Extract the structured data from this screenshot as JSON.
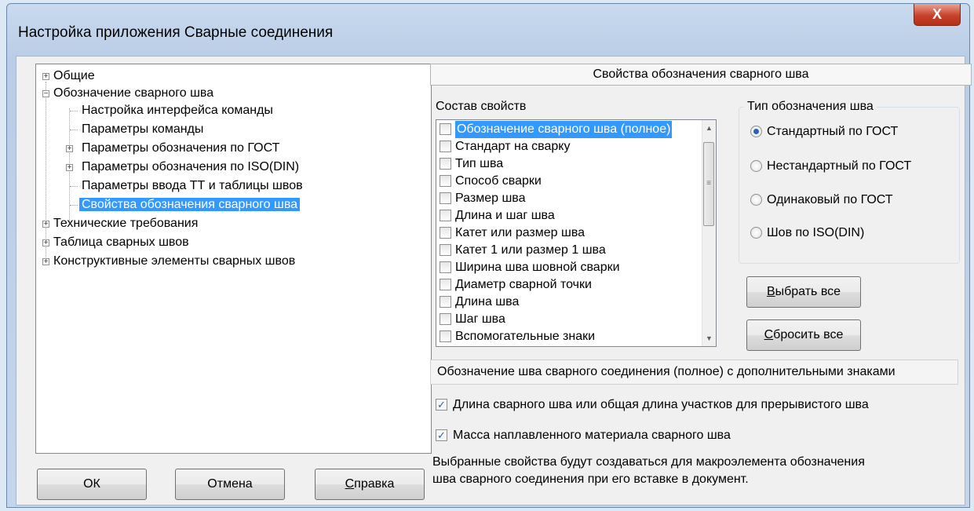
{
  "window": {
    "title": "Настройка приложения Сварные соединения",
    "close_label": "X"
  },
  "tree": {
    "items": [
      {
        "label": "Общие",
        "expander": "+"
      },
      {
        "label": "Обозначение сварного шва",
        "expander": "−"
      },
      {
        "label": "Настройка интерфейса команды"
      },
      {
        "label": "Параметры команды"
      },
      {
        "label": "Параметры обозначения по ГОСТ",
        "expander": "+"
      },
      {
        "label": "Параметры обозначения по ISO(DIN)",
        "expander": "+"
      },
      {
        "label": "Параметры ввода ТТ и таблицы швов"
      },
      {
        "label": "Свойства обозначения сварного шва",
        "selected": true
      },
      {
        "label": "Технические требования",
        "expander": "+"
      },
      {
        "label": "Таблица сварных швов",
        "expander": "+"
      },
      {
        "label": "Конструктивные элементы сварных швов",
        "expander": "+"
      }
    ]
  },
  "buttons": {
    "ok": "ОК",
    "cancel": "Отмена",
    "help_prefix": "С",
    "help_rest": "правка",
    "select_all_prefix": "В",
    "select_all_rest": "ыбрать все",
    "reset_all_prefix": "С",
    "reset_all_rest": "бросить все"
  },
  "panel": {
    "header": "Свойства обозначения сварного шва",
    "properties_label": "Состав свойств",
    "properties": [
      {
        "label": "Обозначение сварного шва (полное)",
        "checked": false,
        "selected": true
      },
      {
        "label": "Стандарт на сварку",
        "checked": false
      },
      {
        "label": "Тип шва",
        "checked": false
      },
      {
        "label": "Способ сварки",
        "checked": false
      },
      {
        "label": "Размер шва",
        "checked": false
      },
      {
        "label": "Длина и шаг шва",
        "checked": false
      },
      {
        "label": "Катет или размер шва",
        "checked": false
      },
      {
        "label": "Катет 1 или размер 1 шва",
        "checked": false
      },
      {
        "label": "Ширина шва шовной сварки",
        "checked": false
      },
      {
        "label": "Диаметр сварной точки",
        "checked": false
      },
      {
        "label": "Длина шва",
        "checked": false
      },
      {
        "label": "Шаг шва",
        "checked": false
      },
      {
        "label": "Вспомогательные знаки",
        "checked": false
      }
    ],
    "type_group_label": "Тип обозначения шва",
    "type_options": [
      {
        "label": "Стандартный по ГОСТ",
        "selected": true
      },
      {
        "label": "Нестандартный по ГОСТ",
        "selected": false
      },
      {
        "label": "Одинаковый по ГОСТ",
        "selected": false
      },
      {
        "label": "Шов по ISO(DIN)",
        "selected": false
      }
    ],
    "description": "Обозначение шва сварного соединения (полное) с дополнительными знаками",
    "options": [
      {
        "label": "Длина сварного шва или общая длина участков для прерывистого шва",
        "checked": true
      },
      {
        "label": "Масса наплавленного материала сварного шва",
        "checked": true
      }
    ],
    "note_line1": "Выбранные свойства будут создаваться для макроэлемента обозначения",
    "note_line2": "шва сварного соединения при его вставке в документ."
  }
}
